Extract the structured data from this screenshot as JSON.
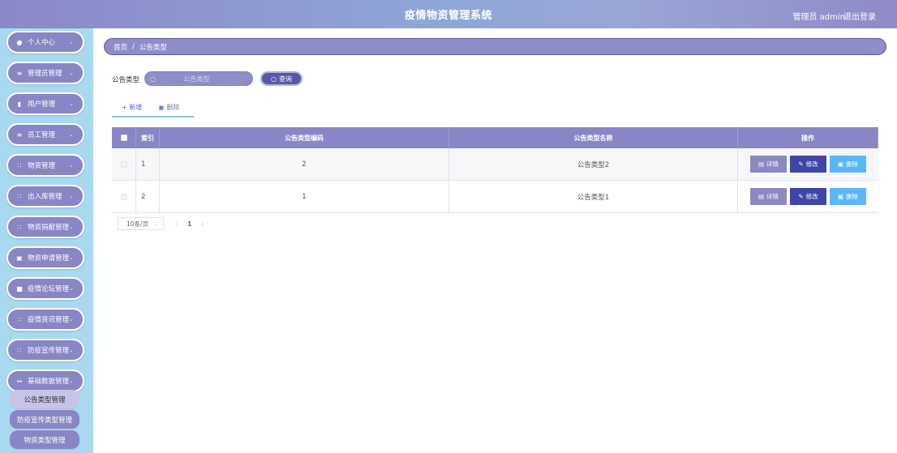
{
  "app": {
    "title": "疫情物资管理系统",
    "user": "管理员 admin",
    "logout": "退出登录"
  },
  "sidebar": {
    "items": [
      {
        "label": "个人中心",
        "icon": "person-icon"
      },
      {
        "label": "管理员管理",
        "icon": "list-icon"
      },
      {
        "label": "用户管理",
        "icon": "bar-chart-icon"
      },
      {
        "label": "员工管理",
        "icon": "list-icon"
      },
      {
        "label": "物资管理",
        "icon": "grid-icon"
      },
      {
        "label": "出入库管理",
        "icon": "grid-icon"
      },
      {
        "label": "物资捐献管理",
        "icon": "grid-icon"
      },
      {
        "label": "物资申请管理",
        "icon": "form-icon"
      },
      {
        "label": "疫情论坛管理",
        "icon": "clipboard-icon"
      },
      {
        "label": "疫情资讯管理",
        "icon": "grid-icon"
      },
      {
        "label": "防疫宣传管理",
        "icon": "grid-icon"
      },
      {
        "label": "基础数据管理",
        "icon": "sliders-icon"
      }
    ],
    "submenu": [
      {
        "label": "公告类型管理",
        "active": true
      },
      {
        "label": "防疫宣传类型管理",
        "active": false
      },
      {
        "label": "物资类型管理",
        "active": false
      }
    ]
  },
  "breadcrumb": {
    "home": "首页",
    "separator": "/",
    "current": "公告类型"
  },
  "search": {
    "label": "公告类型",
    "placeholder": "公告类型",
    "button": "查询"
  },
  "actions": {
    "add": "新增",
    "delete": "删除"
  },
  "table": {
    "columns": [
      "索引",
      "公告类型编码",
      "公告类型名称",
      "操作"
    ],
    "rows": [
      {
        "index": "1",
        "code": "2",
        "name": "公告类型2"
      },
      {
        "index": "2",
        "code": "1",
        "name": "公告类型1"
      }
    ],
    "row_actions": {
      "detail": "详情",
      "edit": "修改",
      "delete": "删除"
    }
  },
  "pagination": {
    "page_size": "10条/页",
    "current_page": "1"
  },
  "colors": {
    "primary": "#8886c4",
    "sidebar_bg": "#a9d9f0",
    "edit": "#3e46a6",
    "delete": "#59b8f5"
  }
}
